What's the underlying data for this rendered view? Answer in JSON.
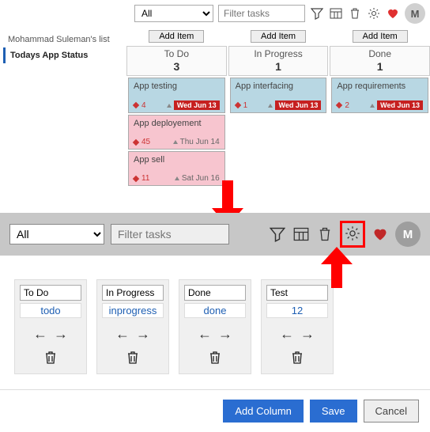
{
  "top": {
    "filter_select": "All",
    "filter_placeholder": "Filter tasks",
    "avatar": "M"
  },
  "sidebar": {
    "items": [
      {
        "label": "Mohammad Suleman's list",
        "active": false
      },
      {
        "label": "Todays App Status",
        "active": true
      }
    ]
  },
  "columns": [
    {
      "add_label": "Add Item",
      "title": "To Do",
      "count": "3",
      "cards": [
        {
          "title": "App testing",
          "count": "4",
          "date": "Wed Jun 13",
          "badge": true,
          "color": "blue"
        },
        {
          "title": "App deployement",
          "count": "45",
          "date": "Thu Jun 14",
          "badge": false,
          "color": "pink"
        },
        {
          "title": "App sell",
          "count": "11",
          "date": "Sat Jun 16",
          "badge": false,
          "color": "pink"
        }
      ]
    },
    {
      "add_label": "Add Item",
      "title": "In Progress",
      "count": "1",
      "cards": [
        {
          "title": "App interfacing",
          "count": "1",
          "date": "Wed Jun 13",
          "badge": true,
          "color": "blue"
        }
      ]
    },
    {
      "add_label": "Add Item",
      "title": "Done",
      "count": "1",
      "cards": [
        {
          "title": "App requirements",
          "count": "2",
          "date": "Wed Jun 13",
          "badge": true,
          "color": "blue"
        }
      ]
    }
  ],
  "mid": {
    "filter_select": "All",
    "filter_placeholder": "Filter tasks",
    "avatar": "M"
  },
  "config": [
    {
      "title": "To Do",
      "slug": "todo"
    },
    {
      "title": "In Progress",
      "slug": "inprogress"
    },
    {
      "title": "Done",
      "slug": "done"
    },
    {
      "title": "Test",
      "slug": "12"
    }
  ],
  "footer": {
    "add_column": "Add Column",
    "save": "Save",
    "cancel": "Cancel"
  }
}
